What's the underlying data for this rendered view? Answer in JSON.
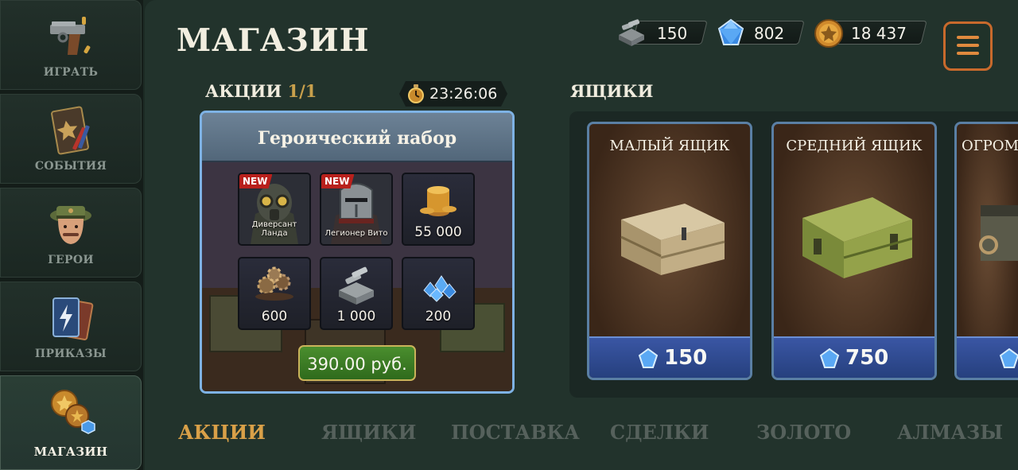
{
  "sidebar": {
    "items": [
      {
        "label": "ИГРАТЬ",
        "icon": "pistol-icon"
      },
      {
        "label": "СОБЫТИЯ",
        "icon": "event-card-icon"
      },
      {
        "label": "ГЕРОИ",
        "icon": "officer-head-icon"
      },
      {
        "label": "ПРИКАЗЫ",
        "icon": "order-cards-icon"
      },
      {
        "label": "МАГАЗИН",
        "icon": "shop-coins-gems-icon"
      }
    ],
    "active_index": 4
  },
  "header": {
    "title": "МАГАЗИН",
    "currencies": [
      {
        "name": "supplies",
        "value": "150",
        "icon": "supplies-icon"
      },
      {
        "name": "gems",
        "value": "802",
        "icon": "gem-icon"
      },
      {
        "name": "gold",
        "value": "18 437",
        "icon": "gold-coin-icon"
      }
    ]
  },
  "promotions": {
    "heading": "АКЦИИ",
    "count": "1/1",
    "timer": "23:26:06",
    "card": {
      "title": "Героический набор",
      "items": [
        {
          "badge": "NEW",
          "caption": "Диверсант Ланда",
          "icon": "gasmask-soldier-icon"
        },
        {
          "badge": "NEW",
          "caption": "Легионер Вито",
          "icon": "knight-helmet-soldier-icon"
        },
        {
          "badge": "",
          "caption": "55 000",
          "icon": "gold-coins-stack-icon"
        },
        {
          "badge": "",
          "caption": "600",
          "icon": "cogs-pile-icon"
        },
        {
          "badge": "",
          "caption": "1 000",
          "icon": "supplies-pile-icon"
        },
        {
          "badge": "",
          "caption": "200",
          "icon": "gems-pile-icon"
        }
      ],
      "price": "390.00 руб."
    }
  },
  "crates": {
    "heading": "ЯЩИКИ",
    "items": [
      {
        "name": "МАЛЫЙ ЯЩИК",
        "price": "150",
        "icon": "wooden-crate-icon"
      },
      {
        "name": "СРЕДНИЙ ЯЩИК",
        "price": "750",
        "icon": "green-crate-icon"
      },
      {
        "name": "ОГРОМ",
        "price": "",
        "icon": "large-crate-icon"
      }
    ]
  },
  "tabs": [
    {
      "label": "АКЦИИ",
      "active": true
    },
    {
      "label": "ЯЩИКИ",
      "active": false
    },
    {
      "label": "ПОСТАВКА",
      "active": false
    },
    {
      "label": "СДЕЛКИ",
      "active": false
    },
    {
      "label": "ЗОЛОТО",
      "active": false
    },
    {
      "label": "АЛМАЗЫ",
      "active": false
    }
  ],
  "colors": {
    "accent_orange": "#d9a048",
    "menu_border": "#c86a2c",
    "buy_green": "#3f7e26",
    "card_border": "#7eb2e4",
    "price_bar_blue": "#2f4a92"
  }
}
